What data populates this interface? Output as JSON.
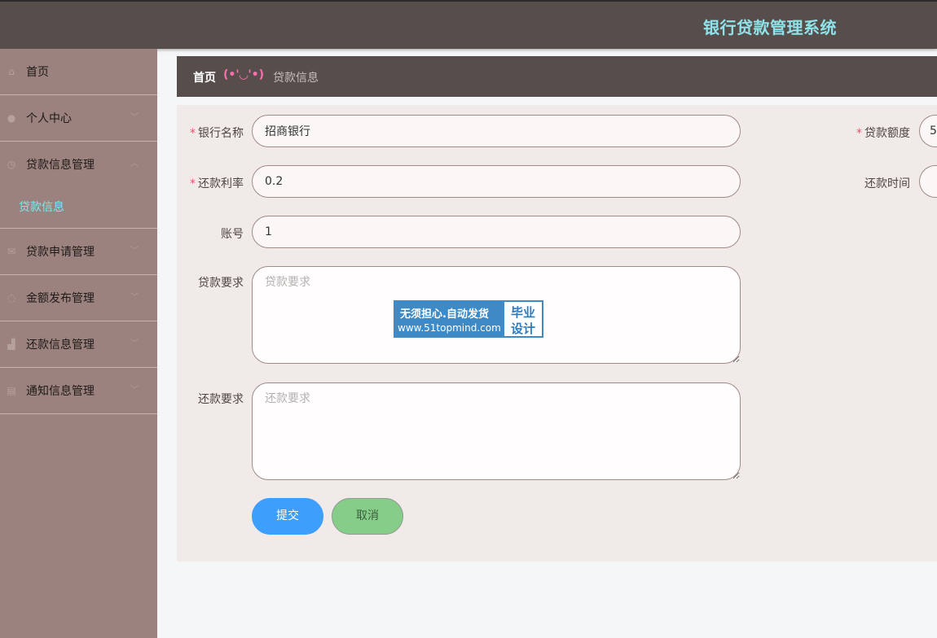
{
  "app": {
    "title": "银行贷款管理系统"
  },
  "sidebar": {
    "items": [
      {
        "label": "首页",
        "icon": "home-icon"
      },
      {
        "label": "个人中心",
        "icon": "user-icon"
      },
      {
        "label": "贷款信息管理",
        "icon": "clock-icon",
        "sub": "贷款信息"
      },
      {
        "label": "贷款申请管理",
        "icon": "mail-icon"
      },
      {
        "label": "金额发布管理",
        "icon": "power-icon"
      },
      {
        "label": "还款信息管理",
        "icon": "chart-icon"
      },
      {
        "label": "通知信息管理",
        "icon": "clipboard-icon"
      }
    ]
  },
  "breadcrumb": {
    "home": "首页",
    "separator": "(•'◡'•)",
    "current": "贷款信息"
  },
  "form": {
    "bank_name": {
      "label": "银行名称",
      "value": "招商银行"
    },
    "loan_amount": {
      "label": "贷款额度",
      "value": "5"
    },
    "interest_rate": {
      "label": "还款利率",
      "value": "0.2"
    },
    "repay_time": {
      "label": "还款时间",
      "value": ""
    },
    "account": {
      "label": "账号",
      "value": "1"
    },
    "loan_req": {
      "label": "贷款要求",
      "placeholder": "贷款要求"
    },
    "repay_req": {
      "label": "还款要求",
      "placeholder": "还款要求"
    },
    "submit_label": "提交",
    "cancel_label": "取消"
  },
  "watermark": {
    "line1": "无须担心.自动发货",
    "line2": "www.51topmind.com",
    "right1": "毕业",
    "right2": "设计"
  },
  "colors": {
    "topbar": "#574e4c",
    "sidebar": "#9b827e",
    "title": "#8fe3e8",
    "submit": "#3e9efc",
    "cancel": "#86cd8a"
  }
}
